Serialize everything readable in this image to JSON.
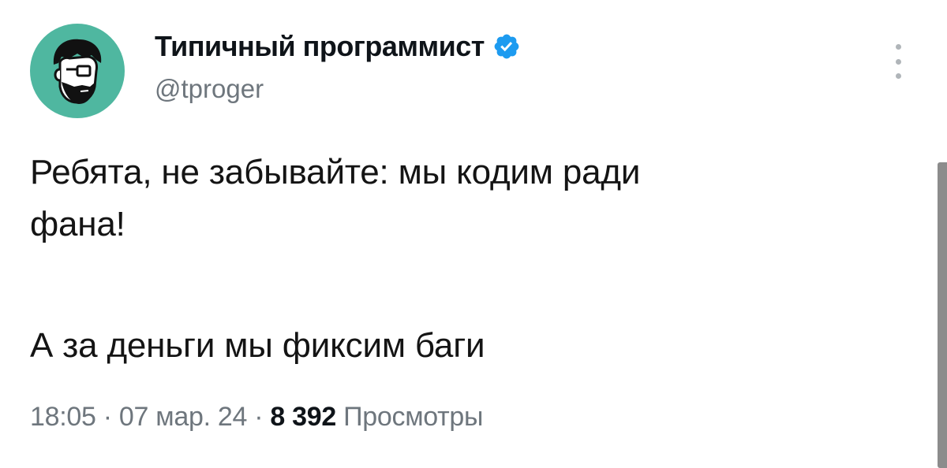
{
  "author": {
    "display_name": "Типичный программист",
    "handle": "@tproger",
    "verified": true,
    "avatar_bg": "#4fb7a0",
    "badge_color": "#1d9bf0"
  },
  "tweet": {
    "line1": "Ребята, не забывайте: мы кодим ради",
    "line2": "фана!",
    "line3": "А за деньги мы фиксим баги"
  },
  "meta": {
    "time": "18:05",
    "separator": " · ",
    "date": "07 мар. 24",
    "views_count": "8 392",
    "views_label": "Просмотры"
  },
  "icons": {
    "more": "more-vertical-icon",
    "verified": "verified-badge-icon",
    "avatar": "avatar-face-icon"
  }
}
